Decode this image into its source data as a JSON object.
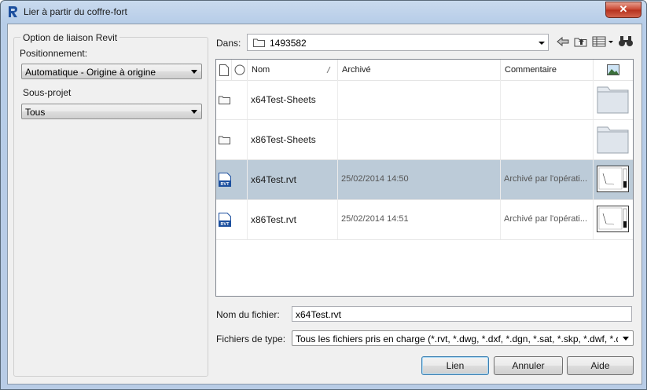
{
  "window": {
    "title": "Lier à partir du coffre-fort",
    "close_label": "✕"
  },
  "left_panel": {
    "group_title": "Option de liaison Revit",
    "positioning_label": "Positionnement:",
    "positioning_value": "Automatique - Origine à origine",
    "subproject_label": "Sous-projet",
    "subproject_value": "Tous"
  },
  "location": {
    "label": "Dans:",
    "path": "1493582"
  },
  "columns": {
    "name": "Nom",
    "archived": "Archivé",
    "comment": "Commentaire"
  },
  "files": [
    {
      "type": "folder",
      "name": "x64Test-Sheets",
      "archived": "",
      "comment": "",
      "selected": false
    },
    {
      "type": "folder",
      "name": "x86Test-Sheets",
      "archived": "",
      "comment": "",
      "selected": false
    },
    {
      "type": "rvt",
      "name": "x64Test.rvt",
      "archived": "25/02/2014 14:50",
      "comment": "Archivé par l'opérati...",
      "selected": true
    },
    {
      "type": "rvt",
      "name": "x86Test.rvt",
      "archived": "25/02/2014 14:51",
      "comment": "Archivé par l'opérati...",
      "selected": false
    }
  ],
  "file_badge": "RVT",
  "filename": {
    "label": "Nom du fichier:",
    "value": "x64Test.rvt"
  },
  "filetype": {
    "label": "Fichiers de type:",
    "value": "Tous les fichiers pris en charge (*.rvt, *.dwg, *.dxf, *.dgn, *.sat, *.skp, *.dwf, *.dw"
  },
  "buttons": {
    "link": "Lien",
    "cancel": "Annuler",
    "help": "Aide"
  },
  "colors": {
    "selection": "#bccbd8",
    "title_bar": "#b9d1ea",
    "close": "#c8442f"
  }
}
